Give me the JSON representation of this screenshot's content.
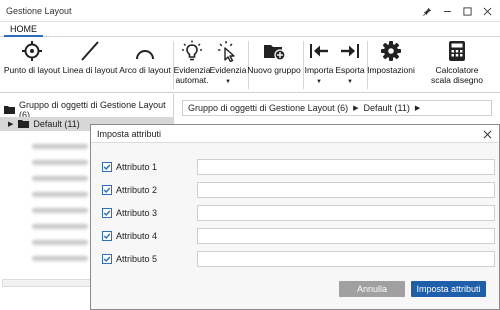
{
  "window": {
    "title": "Gestione Layout"
  },
  "tabs": [
    {
      "label": "HOME"
    }
  ],
  "ribbon": {
    "buttons": [
      {
        "label": "Punto di layout",
        "icon": "target-icon"
      },
      {
        "label": "Linea di layout",
        "icon": "line-icon"
      },
      {
        "label": "Arco di layout",
        "icon": "arc-icon"
      },
      {
        "label": "Evidenzia automat.",
        "icon": "lightbulb-icon"
      },
      {
        "label": "Evidenzia",
        "icon": "cursor-highlight-icon"
      },
      {
        "label": "Nuovo gruppo",
        "icon": "folder-add-icon"
      },
      {
        "label": "Importa",
        "icon": "import-arrow-icon"
      },
      {
        "label": "Esporta",
        "icon": "export-arrow-icon"
      },
      {
        "label": "Impostazioni",
        "icon": "gear-icon"
      },
      {
        "label": "Calcolatore scala disegno",
        "icon": "calculator-icon"
      }
    ]
  },
  "tree": {
    "root": "Gruppo di oggetti di Gestione Layout (6)",
    "child": "Default (11)"
  },
  "breadcrumb": {
    "group": "Gruppo di oggetti di Gestione Layout (6)",
    "item": "Default (11)"
  },
  "dialog": {
    "title": "Imposta attributi",
    "attributes": [
      {
        "label": "Attributo 1",
        "checked": true,
        "value": ""
      },
      {
        "label": "Attributo 2",
        "checked": true,
        "value": ""
      },
      {
        "label": "Attributo 3",
        "checked": true,
        "value": ""
      },
      {
        "label": "Attributo 4",
        "checked": true,
        "value": ""
      },
      {
        "label": "Attributo 5",
        "checked": true,
        "value": ""
      }
    ],
    "cancel_label": "Annulla",
    "apply_label": "Imposta attributi"
  },
  "colors": {
    "accent": "#2f6fba",
    "primary_button": "#1f5ea8",
    "disabled_button": "#a0a0a0"
  }
}
